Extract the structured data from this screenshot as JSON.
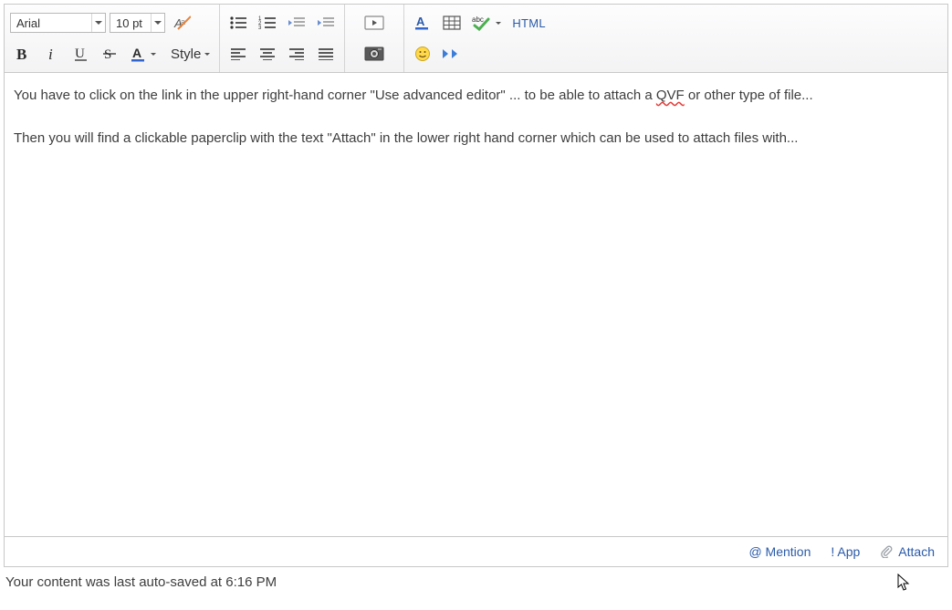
{
  "toolbar": {
    "font_family": "Arial",
    "font_size": "10 pt",
    "style_label": "Style",
    "html_label": "HTML"
  },
  "content": {
    "p1_a": "You have to click on the link in the upper right-hand corner \"Use advanced editor\" ... to be able to attach a ",
    "p1_qvf": "QVF",
    "p1_b": " or other type of file...",
    "p2": "Then you will find a clickable paperclip with the text \"Attach\" in the lower right hand corner which can be used to attach files with..."
  },
  "bottom": {
    "mention": "@ Mention",
    "app": "! App",
    "attach": "Attach"
  },
  "status": "Your content was last auto-saved at 6:16 PM"
}
